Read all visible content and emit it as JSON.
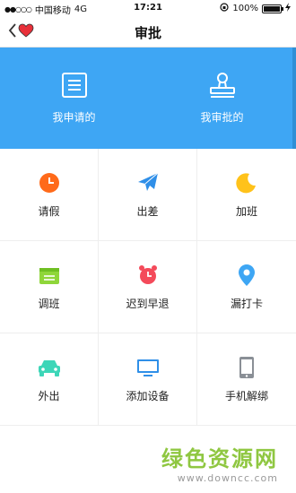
{
  "status_bar": {
    "carrier": "中国移动",
    "network": "4G",
    "time": "17:21",
    "battery": "100%"
  },
  "header": {
    "title": "审批"
  },
  "hero": {
    "items": [
      {
        "label": "我申请的",
        "icon": "document-icon"
      },
      {
        "label": "我审批的",
        "icon": "stamp-icon"
      }
    ]
  },
  "grid": {
    "items": [
      {
        "label": "请假",
        "icon": "clock-icon",
        "color": "#ff6a1a"
      },
      {
        "label": "出差",
        "icon": "airplane-icon",
        "color": "#2f8fe8"
      },
      {
        "label": "加班",
        "icon": "moon-icon",
        "color": "#ffc21a"
      },
      {
        "label": "调班",
        "icon": "schedule-icon",
        "color": "#8fd63a"
      },
      {
        "label": "迟到早退",
        "icon": "alarm-clock-icon",
        "color": "#f44a5a"
      },
      {
        "label": "漏打卡",
        "icon": "location-pin-icon",
        "color": "#3ea6f4"
      },
      {
        "label": "外出",
        "icon": "car-icon",
        "color": "#3dd6b8"
      },
      {
        "label": "添加设备",
        "icon": "monitor-icon",
        "color": "#2f8fe8"
      },
      {
        "label": "手机解绑",
        "icon": "phone-icon",
        "color": "#8a8f96"
      }
    ]
  },
  "watermark": {
    "text": "绿色资源网",
    "url": "www.downcc.com"
  },
  "colors": {
    "hero_bg": "#3ea6f4",
    "accent": "#3ea6f4"
  }
}
